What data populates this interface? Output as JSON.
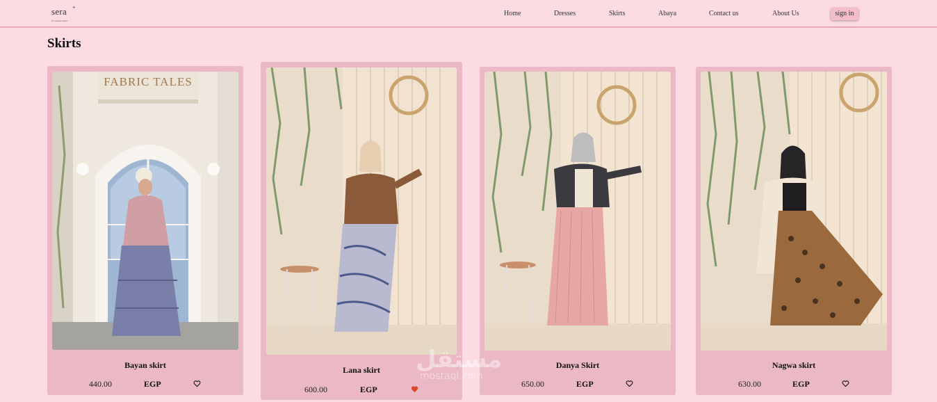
{
  "header": {
    "logo_text": "sera",
    "logo_star": "+",
    "logo_tagline": "for modest skirts",
    "nav": [
      "Home",
      "Dresses",
      "Skirts",
      "Abaya",
      "Contact us",
      "About Us"
    ],
    "signin_label": "sign in"
  },
  "page": {
    "title": "Skirts"
  },
  "products": [
    {
      "name": "Bayan skirt",
      "price": "440.00",
      "currency": "EGP",
      "favorited": false,
      "sign_text": "FABRIC TALES"
    },
    {
      "name": "Lana skirt",
      "price": "600.00",
      "currency": "EGP",
      "favorited": true
    },
    {
      "name": "Danya Skirt",
      "price": "650.00",
      "currency": "EGP",
      "favorited": false
    },
    {
      "name": "Nagwa skirt",
      "price": "630.00",
      "currency": "EGP",
      "favorited": false
    }
  ],
  "watermark": {
    "arabic": "مستقل",
    "latin": "mostaql.com"
  },
  "colors": {
    "background": "#fcdbe3",
    "card": "#ebb8c5",
    "nav_border": "#e9a9b8",
    "heart_active": "#d9482b"
  },
  "icons": {
    "favorite": "heart-outline-icon",
    "favorite_active": "heart-filled-icon"
  }
}
